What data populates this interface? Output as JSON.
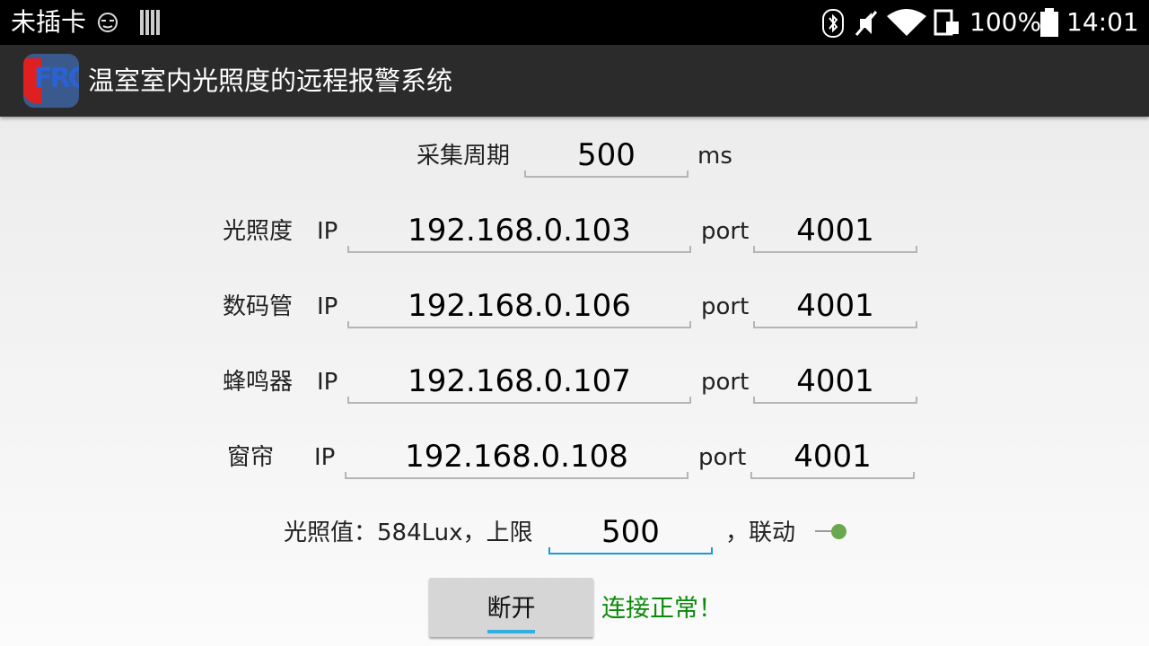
{
  "status_bar": {
    "carrier": "未插卡",
    "battery_percent": "100%",
    "time": "14:01"
  },
  "app": {
    "icon_text": "FRO",
    "title": "温室室内光照度的远程报警系统"
  },
  "collection": {
    "label": "采集周期",
    "value": "500",
    "unit": "ms"
  },
  "devices": [
    {
      "name": "光照度",
      "ip_label": "IP",
      "ip": "192.168.0.103",
      "port_label": "port",
      "port": "4001"
    },
    {
      "name": "数码管",
      "ip_label": "IP",
      "ip": "192.168.0.106",
      "port_label": "port",
      "port": "4001"
    },
    {
      "name": "蜂鸣器",
      "ip_label": "IP",
      "ip": "192.168.0.107",
      "port_label": "port",
      "port": "4001"
    },
    {
      "name": "窗帘",
      "ip_label": "IP",
      "ip": "192.168.0.108",
      "port_label": "port",
      "port": "4001"
    }
  ],
  "threshold": {
    "reading_text": "光照值：584Lux，上限",
    "limit_value": "500",
    "linkage_label": "，联动",
    "linkage_on": true
  },
  "actions": {
    "disconnect_label": "断开",
    "status_message": "连接正常！",
    "status_color": "#0a8a0a"
  }
}
